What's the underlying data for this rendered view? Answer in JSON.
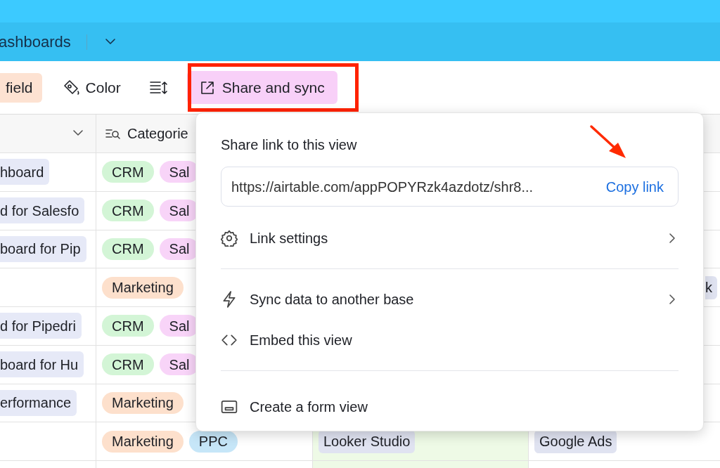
{
  "header": {
    "title": "ashboards"
  },
  "toolbar": [
    {
      "kind": "field",
      "label": "field"
    },
    {
      "kind": "color",
      "label": "Color"
    },
    {
      "kind": "row-height"
    },
    {
      "kind": "share",
      "label": "Share and sync",
      "annotated": true
    }
  ],
  "table": {
    "columns": [
      {
        "kind": "dropdown"
      },
      {
        "kind": "lookup",
        "label": "Categorie"
      }
    ],
    "rows": [
      {
        "name": "hboard",
        "tags": [
          {
            "label": "CRM",
            "color": "#d3f5d6"
          },
          {
            "label": "Sal",
            "color": "#f8d4f8"
          }
        ]
      },
      {
        "name": "d for Salesfo",
        "tags": [
          {
            "label": "CRM",
            "color": "#d3f5d6"
          },
          {
            "label": "Sal",
            "color": "#f8d4f8"
          }
        ]
      },
      {
        "name": "board for Pip",
        "tags": [
          {
            "label": "CRM",
            "color": "#d3f5d6"
          },
          {
            "label": "Sal",
            "color": "#f8d4f8"
          }
        ]
      },
      {
        "tags": [
          {
            "label": "Marketing",
            "color": "#fde0cc"
          }
        ],
        "platform": {
          "label": "k",
          "cut": true
        }
      },
      {
        "name": "d for Pipedri",
        "tags": [
          {
            "label": "CRM",
            "color": "#d3f5d6"
          },
          {
            "label": "Sal",
            "color": "#f8d4f8"
          }
        ]
      },
      {
        "name": "board for Hu",
        "tags": [
          {
            "label": "CRM",
            "color": "#d3f5d6"
          },
          {
            "label": "Sal",
            "color": "#f8d4f8"
          }
        ]
      },
      {
        "name": "erformance",
        "tags": [
          {
            "label": "Marketing",
            "color": "#fde0cc"
          }
        ]
      },
      {
        "tags": [
          {
            "label": "Marketing",
            "color": "#fde0cc"
          },
          {
            "label": "PPC",
            "color": "#c6e6f8"
          }
        ],
        "tool": "Looker Studio",
        "platform": {
          "label": "Google Ads",
          "cut": false
        }
      }
    ]
  },
  "popover": {
    "title": "Share link to this view",
    "url": "https://airtable.com/appPOPYRzk4azdotz/shr8...",
    "copy": "Copy link",
    "sections": [
      [
        {
          "kind": "settings",
          "label": "Link settings",
          "submenu": true
        }
      ],
      [
        {
          "kind": "sync",
          "label": "Sync data to another base",
          "submenu": true
        },
        {
          "kind": "embed",
          "label": "Embed this view",
          "submenu": false
        }
      ],
      [
        {
          "kind": "form",
          "label": "Create a form view",
          "submenu": false
        }
      ]
    ]
  }
}
